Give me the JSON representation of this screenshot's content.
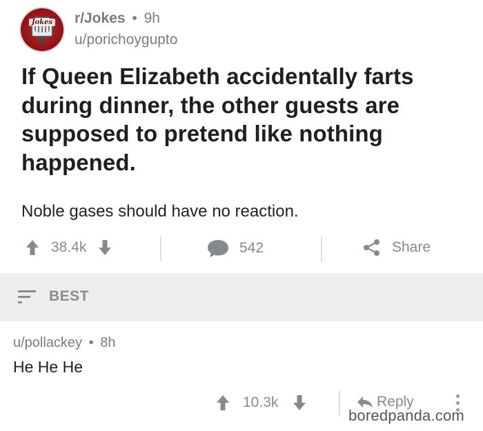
{
  "post": {
    "subreddit": "r/Jokes",
    "time_ago": "9h",
    "separator": "•",
    "author": "u/porichoygupto",
    "subreddit_icon_text": "Jokes",
    "title": "If Queen Elizabeth accidentally farts during dinner, the other guests are supposed to pretend like nothing happened.",
    "body": "Noble gases should have no reaction.",
    "votes": "38.4k",
    "comments": "542",
    "share_label": "Share"
  },
  "sort": {
    "label": "BEST"
  },
  "comment": {
    "author": "u/pollackey",
    "time_ago": "8h",
    "separator": "•",
    "body": "He He He",
    "votes": "10.3k",
    "reply_label": "Reply"
  },
  "watermark": "boredpanda.com",
  "colors": {
    "meta_text": "#7c7c7c",
    "action_text": "#878a8c",
    "sort_bar_bg": "#ededed",
    "subreddit_icon": "#c0262d"
  }
}
